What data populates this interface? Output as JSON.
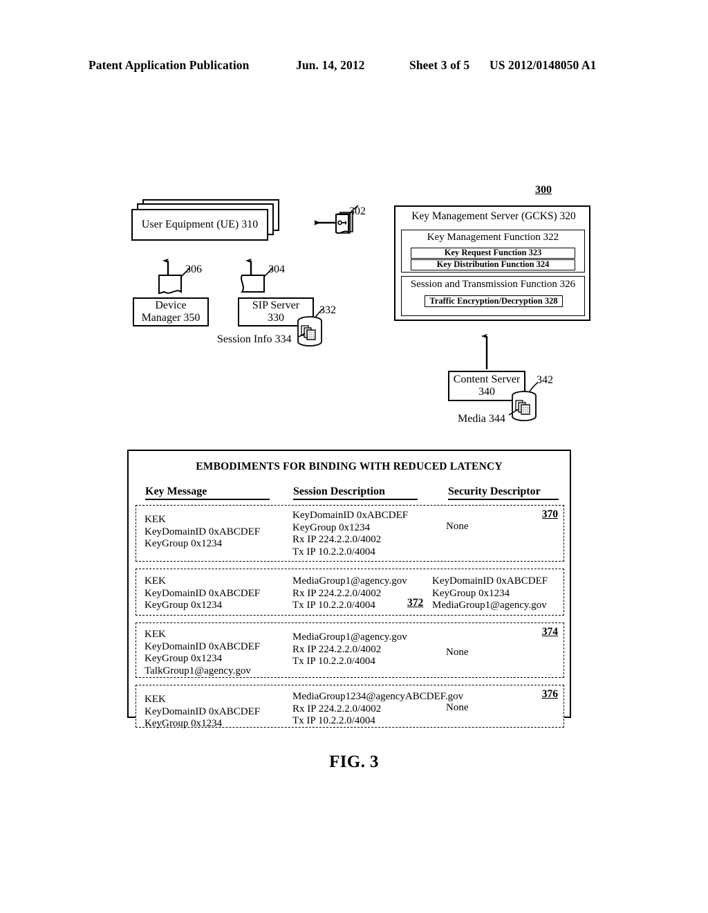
{
  "header": {
    "publication": "Patent Application Publication",
    "date": "Jun. 14, 2012",
    "sheet": "Sheet 3 of 5",
    "patent_number": "US 2012/0148050 A1"
  },
  "figure": {
    "caption": "FIG. 3",
    "system_ref": "300",
    "nodes": {
      "ue": {
        "label": "User Equipment (UE) 310"
      },
      "device_manager": {
        "label": "Device\nManager 350"
      },
      "sip_server": {
        "label": "SIP Server\n330"
      },
      "session_info": {
        "label": "Session Info 334"
      },
      "session_info_ref": "332",
      "kms": {
        "title": "Key Management Server (GCKS) 320",
        "key_management_function": "Key Management Function 322",
        "key_request_function": "Key Request Function 323",
        "key_distribution_function": "Key Distribution Function 324",
        "session_transmission_function": "Session and Transmission Function 326",
        "traffic_encryption": "Traffic Encryption/Decryption 328"
      },
      "content_server": {
        "label": "Content Server\n340"
      },
      "media": {
        "label": "Media 344"
      },
      "media_ref": "342"
    },
    "message_refs": {
      "key_message_302": "302",
      "message_306": "306",
      "message_304": "304"
    }
  },
  "table": {
    "title": "EMBODIMENTS FOR BINDING WITH REDUCED LATENCY",
    "columns": [
      "Key Message",
      "Session Description",
      "Security Descriptor"
    ],
    "rows": [
      {
        "ref": "370",
        "key_message": "KEK\nKeyDomainID  0xABCDEF\nKeyGroup 0x1234",
        "session_description": "KeyDomainID  0xABCDEF\nKeyGroup 0x1234\nRx IP 224.2.2.0/4002\nTx IP 10.2.2.0/4004",
        "security_descriptor": "None"
      },
      {
        "ref": "372",
        "key_message": "KEK\nKeyDomainID  0xABCDEF\nKeyGroup 0x1234",
        "session_description": "MediaGroup1@agency.gov\nRx IP 224.2.2.0/4002\nTx IP 10.2.2.0/4004",
        "security_descriptor": "KeyDomainID  0xABCDEF\nKeyGroup 0x1234\nMediaGroup1@agency.gov"
      },
      {
        "ref": "374",
        "key_message": "KEK\nKeyDomainID  0xABCDEF\nKeyGroup 0x1234\nTalkGroup1@agency.gov",
        "session_description": "MediaGroup1@agency.gov\nRx IP 224.2.2.0/4002\nTx IP 10.2.2.0/4004",
        "security_descriptor": "None"
      },
      {
        "ref": "376",
        "key_message": "KEK\nKeyDomainID  0xABCDEF\nKeyGroup 0x1234",
        "session_description": "MediaGroup1234@agencyABCDEF.gov\nRx IP 224.2.2.0/4002\nTx IP 10.2.2.0/4004",
        "security_descriptor": "None"
      }
    ]
  },
  "colors": {
    "ink": "#000000",
    "paper": "#ffffff"
  }
}
